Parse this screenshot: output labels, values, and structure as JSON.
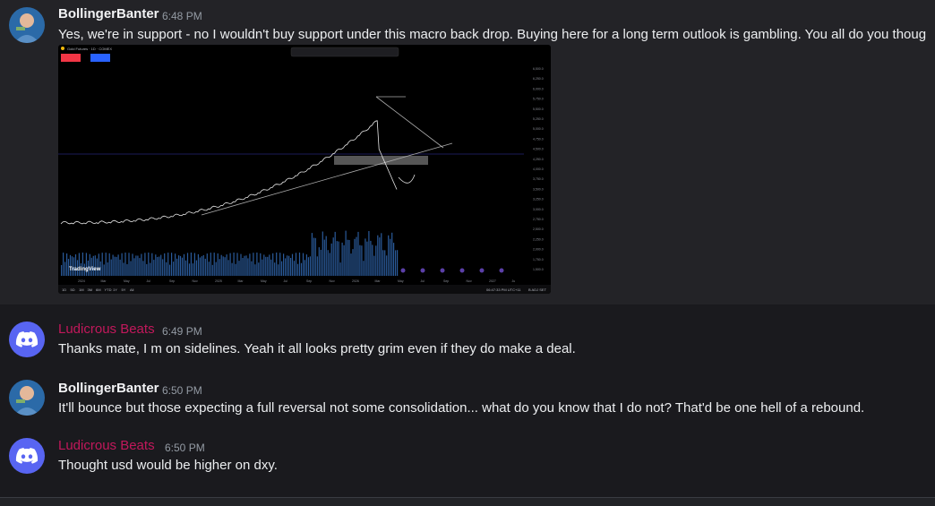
{
  "messages": [
    {
      "author": "BollingerBanter",
      "time": "6:48 PM",
      "text": "Yes, we're in support - no I wouldn't buy support under this macro back drop. Buying here for a long term outlook is gambling. You all do you thoug",
      "attachment": {
        "chart_title": "Gold Futures · 1D · COMEX",
        "watermark": "TradingView",
        "price_ticks": [
          "6,500.0",
          "6,250.0",
          "6,000.0",
          "5,750.0",
          "5,500.0",
          "5,250.0",
          "5,000.0",
          "4,750.0",
          "4,500.0",
          "4,250.0",
          "4,000.0",
          "3,750.0",
          "3,500.0",
          "3,250.0",
          "3,000.0",
          "2,750.0",
          "2,500.0",
          "2,250.0",
          "2,000.0",
          "1,750.0",
          "1,500.0"
        ],
        "time_ticks": [
          "2024",
          "Mar",
          "May",
          "Jul",
          "Sep",
          "Nov",
          "2025",
          "Mar",
          "May",
          "Jul",
          "Sep",
          "Nov",
          "2026",
          "Mar",
          "May",
          "Jul",
          "Sep",
          "Nov",
          "2027",
          "Ju"
        ],
        "ranges": [
          "1D",
          "5D",
          "1M",
          "3M",
          "6M",
          "YTD",
          "1Y",
          "5Y",
          "All"
        ],
        "clock": "06:47:33 PM UTC+11",
        "scale_opts": "B ADJ SET"
      }
    },
    {
      "author": "Ludicrous Beats",
      "time": "6:49 PM",
      "text": "Thanks mate, I m on sidelines. Yeah it all looks pretty grim even if they do make a deal."
    },
    {
      "author": "BollingerBanter",
      "time": "6:50 PM",
      "text": "It'll bounce but those expecting a full reversal not some consolidation... what do you know that I do not? That'd be one hell of a rebound."
    },
    {
      "author": "Ludicrous Beats",
      "time": "6:50 PM",
      "text": "Thought usd would be higher on dxy."
    }
  ],
  "reactions": [
    "👌",
    "😂",
    "🔴"
  ],
  "colors": {
    "author_user": "#f2f3f5",
    "author_bot": "#c2185b",
    "discord": "#5865f2",
    "accent_blue": "#2962ff"
  }
}
